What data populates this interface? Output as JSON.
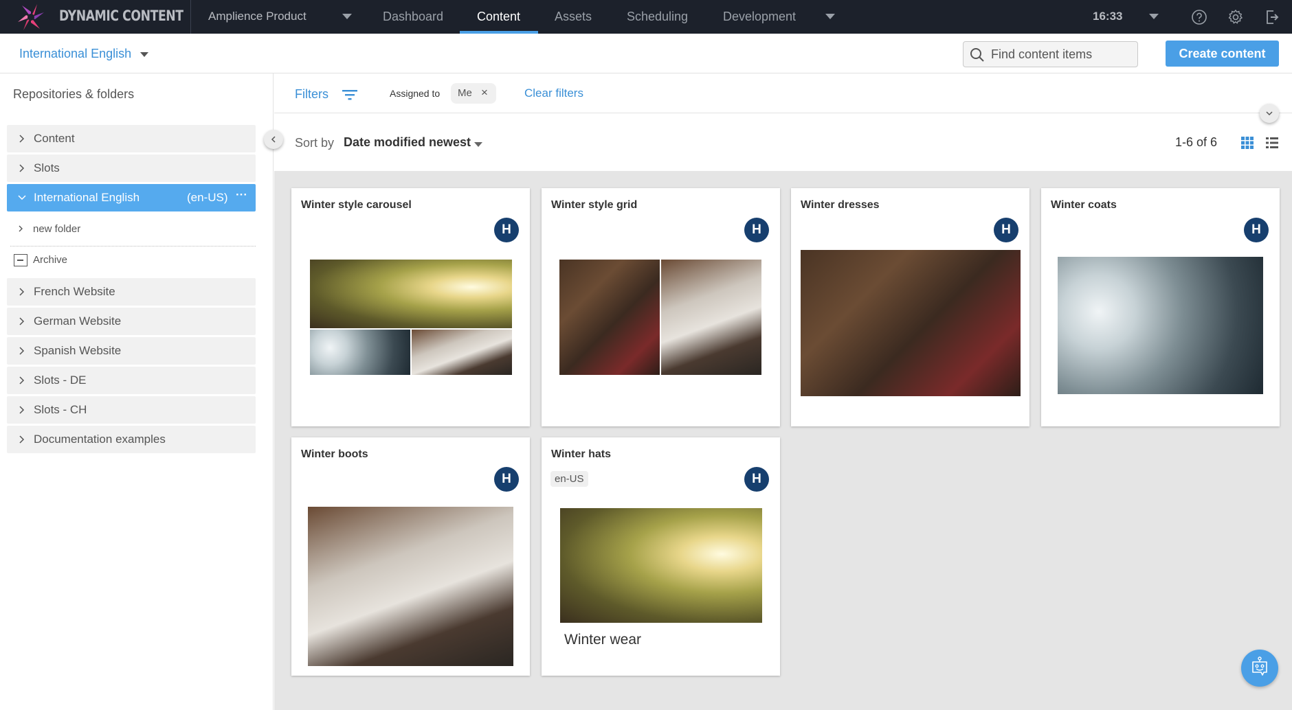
{
  "topbar": {
    "brand": "DYNAMIC CONTENT",
    "hub": "Amplience Product",
    "tabs": [
      {
        "label": "Dashboard",
        "active": false
      },
      {
        "label": "Content",
        "active": true
      },
      {
        "label": "Assets",
        "active": false
      },
      {
        "label": "Scheduling",
        "active": false
      },
      {
        "label": "Development",
        "active": false
      }
    ],
    "time": "16:33",
    "icons": [
      "help-icon",
      "settings-icon",
      "logout-icon"
    ]
  },
  "subbar": {
    "locale": "International English",
    "search_placeholder": "Find content items",
    "create_label": "Create content"
  },
  "sidebar": {
    "title": "Repositories & folders",
    "items": [
      {
        "label": "Content"
      },
      {
        "label": "Slots"
      },
      {
        "label": "International English",
        "locale": "(en-US)",
        "more": "···",
        "selected": true
      },
      {
        "label": "new folder"
      },
      {
        "label": "Archive"
      },
      {
        "label": "French Website"
      },
      {
        "label": "German Website"
      },
      {
        "label": "Spanish Website"
      },
      {
        "label": "Slots - DE"
      },
      {
        "label": "Slots - CH"
      },
      {
        "label": "Documentation examples"
      }
    ]
  },
  "filters": {
    "label": "Filters",
    "assigned_label": "Assigned to",
    "assigned_value": "Me",
    "remove": "×",
    "clear_label": "Clear filters"
  },
  "sort": {
    "label": "Sort by",
    "value": "Date modified newest",
    "count": "1-6 of 6"
  },
  "cards": [
    {
      "title": "Winter style carousel",
      "avatar": "H"
    },
    {
      "title": "Winter style grid",
      "avatar": "H"
    },
    {
      "title": "Winter dresses",
      "avatar": "H"
    },
    {
      "title": "Winter coats",
      "avatar": "H"
    },
    {
      "title": "Winter boots",
      "avatar": "H"
    },
    {
      "title": "Winter hats",
      "avatar": "H",
      "locale": "en-US",
      "caption": "Winter wear"
    }
  ],
  "colors": {
    "topbar_bg": "#1c212b",
    "accent": "#4a9fe6",
    "selected_item": "#55aaee",
    "avatar_bg": "#173f6e"
  }
}
